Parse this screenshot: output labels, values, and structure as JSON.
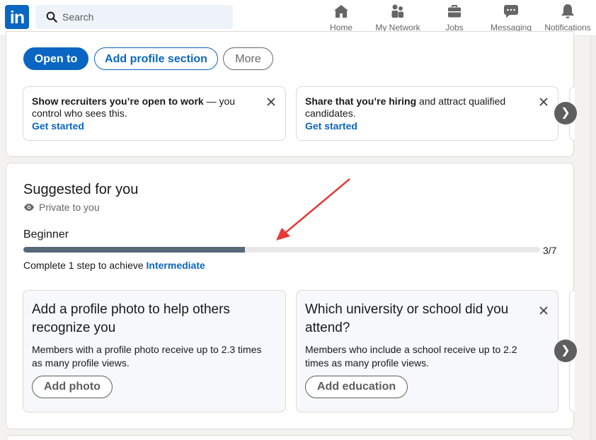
{
  "nav": {
    "logo": "in",
    "search": {
      "placeholder": "Search"
    },
    "items": [
      {
        "label": "Home",
        "icon": "home-icon"
      },
      {
        "label": "My Network",
        "icon": "network-icon"
      },
      {
        "label": "Jobs",
        "icon": "briefcase-icon"
      },
      {
        "label": "Messaging",
        "icon": "messaging-icon"
      },
      {
        "label": "Notifications",
        "icon": "bell-icon"
      }
    ]
  },
  "profile_actions": {
    "open_to": "Open to",
    "add_section": "Add profile section",
    "more": "More"
  },
  "promo_cards": [
    {
      "bold": "Show recruiters you’re open to work",
      "rest": " — you control who sees this.",
      "link": "Get started"
    },
    {
      "bold": "Share that you’re hiring",
      "rest": " and attract qualified candidates.",
      "link": "Get started"
    }
  ],
  "suggested": {
    "title": "Suggested for you",
    "privacy": "Private to you",
    "level": "Beginner",
    "progress": {
      "completed": 3,
      "total": 7,
      "label": "3/7"
    },
    "step_prefix": "Complete 1 step to achieve ",
    "step_target": "Intermediate",
    "cards": [
      {
        "title": "Add a profile photo to help others recognize you",
        "desc": "Members with a profile photo receive up to 2.3 times as many profile views.",
        "button": "Add photo"
      },
      {
        "title": "Which university or school did you attend?",
        "desc": "Members who include a school receive up to 2.2 times as many profile views.",
        "button": "Add education"
      }
    ]
  },
  "colors": {
    "brand": "#0a66c2",
    "progress_fill": "#56687a",
    "annotation_arrow": "#e53935"
  }
}
